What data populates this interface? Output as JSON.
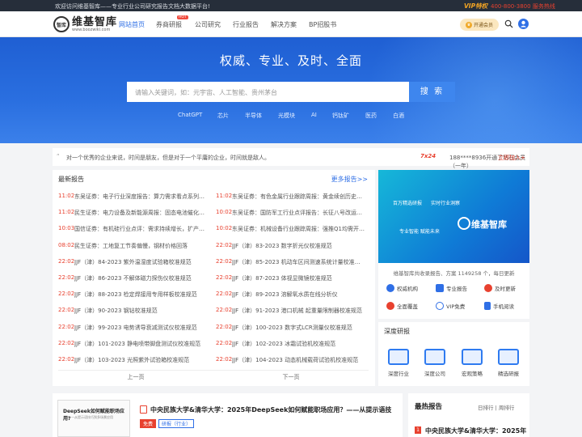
{
  "topbar": {
    "welcome": "欢迎访问维基智库——专业行业公司研究报告文档大数据平台!",
    "vip": "VIP特权",
    "phone": "400-800-3800 服务热线"
  },
  "logo": {
    "name": "维基智库",
    "url": "www.boozwiki.com",
    "mark": "智库"
  },
  "nav": {
    "items": [
      "网站首页",
      "券商研报",
      "公司研究",
      "行业报告",
      "解决方案",
      "BP招股书"
    ],
    "hot_badge": "HOT",
    "member": "开通会员"
  },
  "hero": {
    "title": "权威、专业、及时、全面",
    "placeholder": "请输入关键词，如：元宇宙、人工智能、贵州茅台",
    "search": "搜 索",
    "keywords": [
      "ChatGPT",
      "芯片",
      "半导体",
      "光模块",
      "AI",
      "钙钛矿",
      "医药",
      "白酒"
    ]
  },
  "notice": {
    "quote": "“",
    "text": "对一个优秀的企业来说，时间是朋友，但是对于一个平庸的企业，时间就是敌人。",
    "tag": "7x24",
    "right_text": "188****8936开通了钻石会员（一年）",
    "join": "立即加入+"
  },
  "latest": {
    "title": "最新报告",
    "more": "更多报告>>",
    "left": [
      [
        "11:02",
        "东吴证券：电子行业深度报告：算力需求看点系列…"
      ],
      [
        "11:02",
        "民生证券：电力设备及新能源周报：固态电池催化…"
      ],
      [
        "10:03",
        "国信证券：有机硅行业点评：需求持续增长，扩产…"
      ],
      [
        "08:02",
        "民生证券：工地复工节奏偏慢，钢材价格回落"
      ],
      [
        "22:02",
        "JJF（津）84-2023 紫外温湿度试验箱校准规范"
      ],
      [
        "22:02",
        "JJF（津）86-2023 不解体磁力探伤仪校准规范"
      ],
      [
        "22:02",
        "JJF（津）88-2023 检定焊接用专用样板校准规范"
      ],
      [
        "22:02",
        "JJF（津）90-2023 钢钻校准规范"
      ],
      [
        "22:02",
        "JJF（津）99-2023 电势诱导衰减测试仪校准规范"
      ],
      [
        "22:02",
        "JJF（津）101-2023 静电喷带脚盘测试仪校准规范"
      ],
      [
        "22:02",
        "JJF（津）103-2023 光照紫外试验箱校准规范"
      ]
    ],
    "right": [
      [
        "11:02",
        "东吴证券：有色金属行业跟踪周报：黄金续创历史…"
      ],
      [
        "10:02",
        "东吴证券：国防军工行业点评报告：长征八号改运…"
      ],
      [
        "10:02",
        "东吴证券：机械设备行业跟踪周报：强推Q1均需开…"
      ],
      [
        "22:02",
        "JJF（津）83-2023 数字折光仪校准规范"
      ],
      [
        "22:02",
        "JJF（津）85-2023 机动车区间测速系统计量校准…"
      ],
      [
        "22:02",
        "JJF（津）87-2023 体视显微镜校准规范"
      ],
      [
        "22:02",
        "JJF（津）89-2023 溶解氧水质在线分析仪"
      ],
      [
        "22:02",
        "JJF（津）91-2023 港口机械 起重量限制器校准规范"
      ],
      [
        "22:02",
        "JJF（津）100-2023 数字式LCR测量仪校准规范"
      ],
      [
        "22:02",
        "JJF（津）102-2023 冰霜试验机校准规范"
      ],
      [
        "22:02",
        "JJF（津）104-2023 动态机械载荷试验机校准规范"
      ]
    ],
    "prev": "上一页",
    "next": "下一页"
  },
  "side": {
    "banner1": "百万精选研报",
    "banner2": "实时行业洞察",
    "banner3": "专业智能 赋能未来",
    "banner_logo": "维基智库",
    "stats": "维基智库共收录报告、方案 1149258 个，每日更新",
    "features": [
      "权威机构",
      "专业报告",
      "及时更新",
      "全面覆盖",
      "VIP免费",
      "手机阅读"
    ]
  },
  "deep": {
    "title": "深度研报",
    "items": [
      "深度行业",
      "深度公司",
      "宏观策略",
      "精选研报"
    ]
  },
  "report": {
    "thumb_title": "DeepSeek如何赋能职场应用?",
    "thumb_sub": "——从提示语技巧到多场景应用",
    "title": "中央民族大学&清华大学：2025年DeepSeek如何赋能职场应用？——从提示语技",
    "tag": "免费",
    "cat": "研报（行业）"
  },
  "ranking": {
    "title": "最热报告",
    "tabs": "日排行 | 周排行",
    "first_num": "1",
    "first": "中央民族大学&清华大学：2025年"
  }
}
